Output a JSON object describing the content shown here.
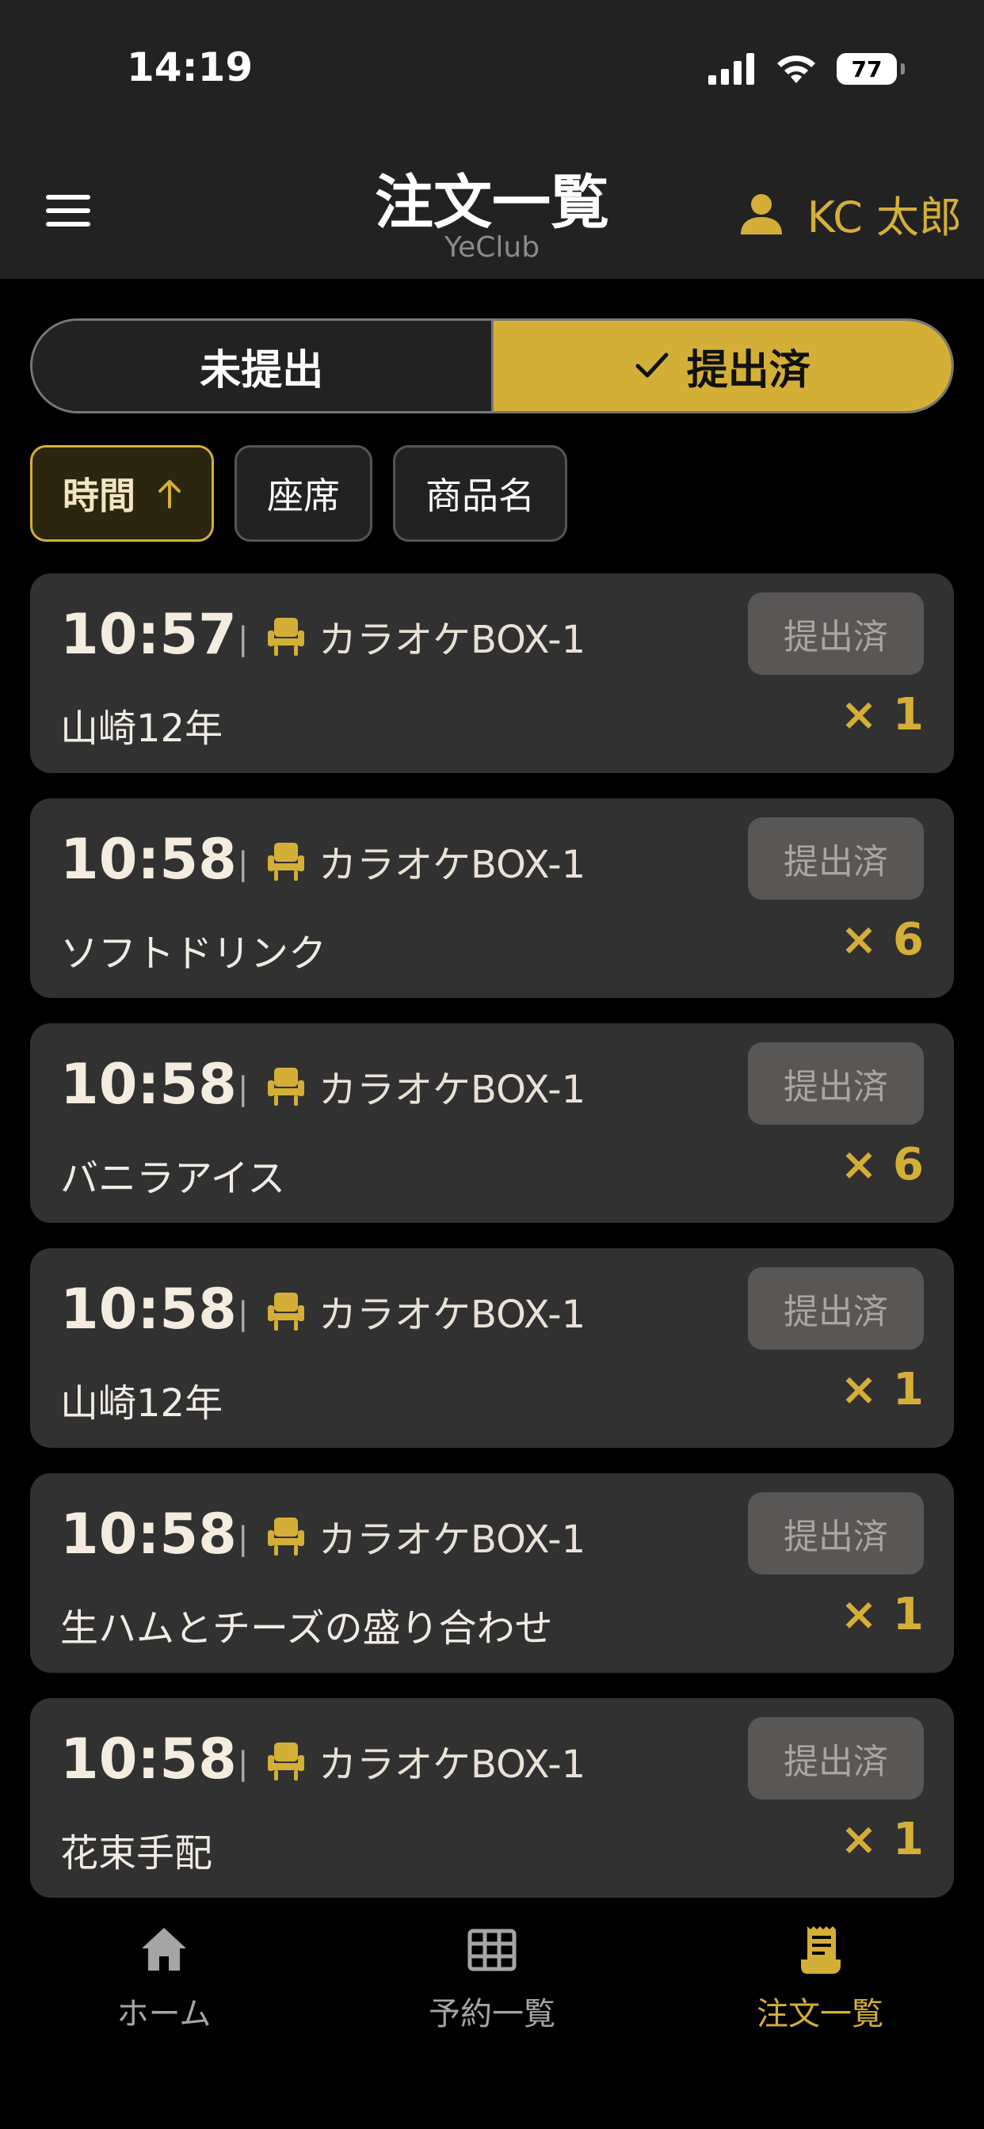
{
  "status_bar": {
    "time": "14:19",
    "battery": "77"
  },
  "header": {
    "title": "注文一覧",
    "subtitle": "YeClub",
    "user_name": "KC 太郎"
  },
  "segment": {
    "unsubmitted_label": "未提出",
    "submitted_label": "提出済",
    "selected": "submitted"
  },
  "sort_chips": [
    {
      "label": "時間",
      "active": true
    },
    {
      "label": "座席",
      "active": false
    },
    {
      "label": "商品名",
      "active": false
    }
  ],
  "orders": [
    {
      "time": "10:57",
      "seat": "カラオケBOX-1",
      "item": "山崎12年",
      "qty": "1",
      "status": "提出済"
    },
    {
      "time": "10:58",
      "seat": "カラオケBOX-1",
      "item": "ソフトドリンク",
      "qty": "6",
      "status": "提出済"
    },
    {
      "time": "10:58",
      "seat": "カラオケBOX-1",
      "item": "バニラアイス",
      "qty": "6",
      "status": "提出済"
    },
    {
      "time": "10:58",
      "seat": "カラオケBOX-1",
      "item": "山崎12年",
      "qty": "1",
      "status": "提出済"
    },
    {
      "time": "10:58",
      "seat": "カラオケBOX-1",
      "item": "生ハムとチーズの盛り合わせ",
      "qty": "1",
      "status": "提出済"
    },
    {
      "time": "10:58",
      "seat": "カラオケBOX-1",
      "item": "花束手配",
      "qty": "1",
      "status": "提出済"
    }
  ],
  "qty_prefix": "×",
  "tabbar": {
    "home_label": "ホーム",
    "reservations_label": "予約一覧",
    "orders_label": "注文一覧",
    "active": "orders"
  },
  "colors": {
    "accent": "#d4af37",
    "background": "#000000",
    "header": "#222222",
    "card": "#323131",
    "status_pill": "#595756"
  },
  "icons": {
    "menu": "hamburger-menu-icon",
    "user": "user-icon",
    "check": "check-icon",
    "sort": "arrow-up-icon",
    "seat": "chair-icon",
    "home": "home-icon",
    "reservations": "grid-icon",
    "orders": "receipt-icon"
  }
}
